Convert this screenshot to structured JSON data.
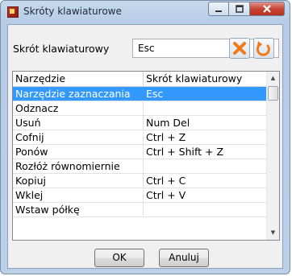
{
  "window": {
    "title": "Skróty klawiaturowe"
  },
  "shortcut": {
    "label": "Skrót klawiaturowy",
    "value": "Esc"
  },
  "table": {
    "headers": [
      "Narzędzie",
      "Skrót klawiaturowy"
    ],
    "rows": [
      {
        "tool": "Narzędzie zaznaczania",
        "shortcut": "Esc",
        "selected": true
      },
      {
        "tool": "Odznacz",
        "shortcut": ""
      },
      {
        "tool": "Usuń",
        "shortcut": "Num Del"
      },
      {
        "tool": "Cofnij",
        "shortcut": "Ctrl + Z"
      },
      {
        "tool": "Ponów",
        "shortcut": "Ctrl + Shift + Z"
      },
      {
        "tool": "Rozłóż równomiernie",
        "shortcut": ""
      },
      {
        "tool": "Kopiuj",
        "shortcut": "Ctrl + C"
      },
      {
        "tool": "Wklej",
        "shortcut": "Ctrl + V"
      },
      {
        "tool": "Wstaw półkę",
        "shortcut": ""
      }
    ]
  },
  "buttons": {
    "ok": "OK",
    "cancel": "Anuluj"
  },
  "icons": {
    "clear": "clear-x-icon",
    "reset": "reset-arrow-icon"
  },
  "colors": {
    "selection": "#3399ff",
    "clear_icon": "#f07a1a",
    "reset_icon": "#f07a1a"
  }
}
